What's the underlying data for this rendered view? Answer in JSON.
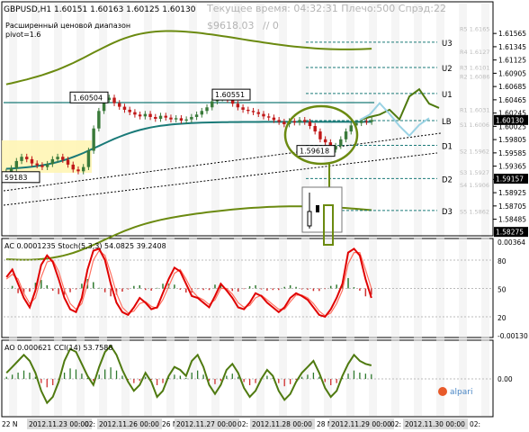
{
  "header": {
    "symbol_line": "GBPUSD,H1  1.60151 1.60163 1.60125 1.60130",
    "server_time": "Текущее время: 04:32:31 Плечо:500 Спрэд:22",
    "balance": "$9618.03",
    "balance_suffix": "// 0",
    "indicator_title": "Расширенный ценовой диапазон",
    "indicator_param": "pivot=1.6"
  },
  "chart_data": [
    {
      "type": "line",
      "name": "GBPUSD H1 price panel",
      "ylim": [
        1.5824,
        1.6206
      ],
      "price_ticks": [
        "1.61565",
        "1.61345",
        "1.61125",
        "1.60905",
        "1.60685",
        "1.60465",
        "1.60245",
        "1.60025",
        "1.59805",
        "1.59585",
        "1.59365",
        "1.59145",
        "1.58925",
        "1.58705",
        "1.58485"
      ],
      "highlight_ticks": [
        {
          "label": "1.60130",
          "value": 1.6013,
          "color": "#000000"
        },
        {
          "label": "1.59157",
          "value": 1.59157,
          "color": "#000000"
        },
        {
          "label": "1.58275",
          "value": 1.58275,
          "color": "#000000"
        }
      ],
      "pivot_levels": [
        {
          "label": "U3",
          "value": 1.6142
        },
        {
          "label": "U2",
          "value": 1.61
        },
        {
          "label": "U1",
          "value": 1.6057
        },
        {
          "label": "LB",
          "value": 1.6012
        },
        {
          "label": "D1",
          "value": 1.5971
        },
        {
          "label": "D2",
          "value": 1.5916
        },
        {
          "label": "D3",
          "value": 1.5863
        }
      ],
      "resistance_labels": [
        "R5 1.6165",
        "R4 1.6127",
        "R3 1.6101",
        "R2 1.6086",
        "R1 1.6031"
      ],
      "support_labels": [
        "S1 1.6006",
        "S2 1.5962",
        "S3 1.5927",
        "S4 1.5906",
        "S5 1.5862"
      ],
      "annotations": [
        {
          "text": "1.60504",
          "value": 1.60504
        },
        {
          "text": "1.60551",
          "value": 1.60551
        },
        {
          "text": "1.59618",
          "value": 1.59618
        },
        {
          "text": "59183",
          "value": 1.59183
        }
      ],
      "close": [
        1.5927,
        1.5933,
        1.5945,
        1.5952,
        1.5948,
        1.5941,
        1.5938,
        1.5935,
        1.594,
        1.5948,
        1.5952,
        1.5947,
        1.5939,
        1.5931,
        1.5928,
        1.5935,
        1.5962,
        1.5999,
        1.6028,
        1.6046,
        1.605,
        1.6041,
        1.6035,
        1.603,
        1.6026,
        1.6022,
        1.6019,
        1.6023,
        1.6018,
        1.6015,
        1.602,
        1.6017,
        1.6014,
        1.6016,
        1.6012,
        1.6014,
        1.6018,
        1.6022,
        1.6028,
        1.6034,
        1.6044,
        1.6049,
        1.6052,
        1.6047,
        1.604,
        1.6034,
        1.603,
        1.6028,
        1.6026,
        1.6023,
        1.6019,
        1.6017,
        1.6013,
        1.601,
        1.6006,
        1.6011,
        1.6009,
        1.6013,
        1.601,
        1.6003,
        1.5994,
        1.5981,
        1.5976,
        1.5964,
        1.597,
        1.5981,
        1.5994,
        1.6004,
        1.6008,
        1.6011,
        1.601,
        1.6013
      ],
      "forecast": [
        1.6013,
        1.6018,
        1.6022,
        1.603,
        1.6014,
        1.6052,
        1.6064,
        1.604,
        1.6033
      ],
      "forecast_alt": [
        1.6013,
        1.6022,
        1.6041,
        1.6023,
        1.6003,
        1.5987,
        1.6005,
        1.6016
      ]
    },
    {
      "type": "line",
      "name": "AC Stoch panel",
      "title": "AC 0.0001235  Stoch(5,3,3) 54.0825 39.2408",
      "ylim": [
        -0.0013,
        0.00364
      ],
      "ticks": [
        "0.00364",
        "80",
        "50",
        "20",
        "-0.00130"
      ],
      "stoch_main": [
        62,
        70,
        55,
        40,
        30,
        48,
        75,
        85,
        78,
        60,
        40,
        28,
        25,
        40,
        70,
        90,
        92,
        80,
        55,
        35,
        25,
        22,
        30,
        40,
        35,
        28,
        30,
        45,
        60,
        72,
        68,
        55,
        42,
        40,
        35,
        30,
        42,
        55,
        48,
        40,
        30,
        28,
        35,
        45,
        42,
        35,
        30,
        25,
        30,
        40,
        45,
        42,
        38,
        30,
        22,
        20,
        28,
        40,
        55,
        88,
        92,
        85,
        60,
        40
      ],
      "stoch_signal": [
        60,
        65,
        60,
        45,
        34,
        40,
        62,
        78,
        80,
        68,
        48,
        34,
        28,
        34,
        55,
        80,
        90,
        85,
        66,
        45,
        30,
        24,
        26,
        34,
        36,
        31,
        29,
        38,
        52,
        66,
        70,
        60,
        48,
        41,
        38,
        33,
        38,
        50,
        50,
        44,
        35,
        30,
        32,
        40,
        43,
        38,
        33,
        28,
        28,
        36,
        43,
        43,
        40,
        34,
        26,
        21,
        24,
        34,
        48,
        76,
        88,
        88,
        70,
        50
      ]
    },
    {
      "type": "line",
      "name": "AO CCI panel",
      "title": "AO 0.000621  CCI(14) 53.7588",
      "ticks": [
        "0.00"
      ],
      "cci": [
        20,
        40,
        60,
        80,
        60,
        20,
        -40,
        -80,
        -60,
        -10,
        60,
        100,
        90,
        50,
        10,
        -20,
        40,
        90,
        110,
        80,
        30,
        -10,
        -40,
        -20,
        20,
        -10,
        -60,
        -40,
        10,
        40,
        30,
        10,
        60,
        80,
        40,
        -20,
        -50,
        -20,
        30,
        50,
        20,
        -30,
        -60,
        -40,
        0,
        30,
        10,
        -40,
        -70,
        -50,
        -10,
        20,
        40,
        60,
        20,
        -30,
        -60,
        -40,
        10,
        50,
        80,
        60,
        50,
        45
      ]
    }
  ],
  "x_axis_labels": [
    "22 N",
    "2012.11.23 00:00",
    "02:",
    "2012.11.26 00:00",
    "26 N",
    "2012.11.27 00:00",
    "02:",
    "2012.11.28 00:00",
    "28 N",
    "2012.11.29 00:00",
    "02:",
    "2012.11.30 00:00",
    "02:"
  ],
  "watermark": "alpari",
  "colors": {
    "candle_up": "#3a7a3a",
    "candle_down": "#c01818",
    "pivot_olive": "#6b8a10",
    "teal": "#1a7a78",
    "stoch_main": "#e00000",
    "stoch_signal": "#ff7060",
    "cci": "#4f7a10",
    "highlight_box": "#fff4b0"
  }
}
